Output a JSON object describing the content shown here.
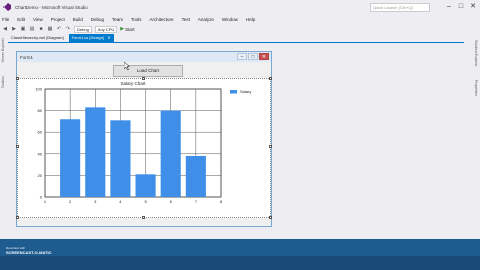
{
  "app": {
    "title": "ChartDemo - Microsoft Visual Studio",
    "quick_launch_placeholder": "Quick Launch (Ctrl+Q)"
  },
  "menu": [
    "File",
    "Edit",
    "View",
    "Project",
    "Build",
    "Debug",
    "Team",
    "Tools",
    "Architecture",
    "Test",
    "Analyze",
    "Window",
    "Help"
  ],
  "toolbar": {
    "config": "Debug",
    "platform": "Any CPU",
    "start_label": "Start"
  },
  "doc_tabs": [
    {
      "label": "ClassHierarchy.xml [Diagram]",
      "active": false
    },
    {
      "label": "Form1.cs [Design]",
      "active": true
    }
  ],
  "left_tabs": [
    "Server Explorer",
    "Toolbox"
  ],
  "right_tabs": [
    "Solution Explorer",
    "Properties"
  ],
  "form": {
    "title": "Form1",
    "button_label": "Load Chart"
  },
  "chart_data": {
    "type": "bar",
    "title": "Salary Chart",
    "legend": [
      "Salary"
    ],
    "legend_position": "top-right",
    "x": [
      2,
      3,
      4,
      5,
      6,
      7
    ],
    "values": [
      72,
      83,
      71,
      21,
      80,
      38
    ],
    "xlim": [
      1,
      8
    ],
    "ylim": [
      0,
      100
    ],
    "xticks": [
      "1",
      "2",
      "3",
      "4",
      "5",
      "6",
      "7",
      "8"
    ],
    "yticks": [
      "0",
      "20",
      "40",
      "60",
      "80",
      "100"
    ],
    "grid": true,
    "bar_color": "#3f8fe8"
  },
  "watermark": {
    "line1": "Recorded with",
    "line2": "SCREENCAST-O-MATIC"
  },
  "colors": {
    "accent": "#007acc"
  }
}
